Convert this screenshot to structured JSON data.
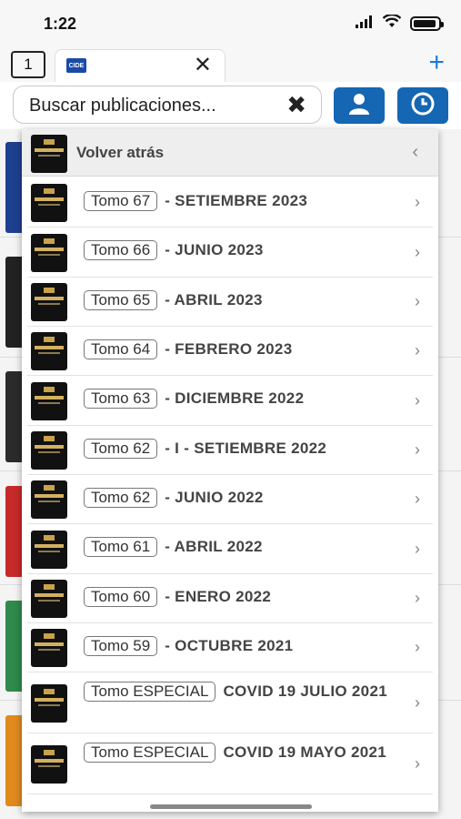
{
  "status_bar": {
    "time": "1:22"
  },
  "tabs": {
    "count": "1",
    "favicon_text": "CIDE"
  },
  "search": {
    "placeholder": "Buscar publicaciones..."
  },
  "menu": {
    "back_label": "Volver atrás",
    "items": [
      {
        "tomo": "Tomo 67",
        "title": "- SETIEMBRE 2023"
      },
      {
        "tomo": "Tomo 66",
        "title": "- JUNIO 2023"
      },
      {
        "tomo": "Tomo 65",
        "title": "- ABRIL 2023"
      },
      {
        "tomo": "Tomo 64",
        "title": "- FEBRERO 2023"
      },
      {
        "tomo": "Tomo 63",
        "title": "- DICIEMBRE 2022"
      },
      {
        "tomo": "Tomo 62",
        "title": "- I - SETIEMBRE 2022"
      },
      {
        "tomo": "Tomo 62",
        "title": "- JUNIO 2022"
      },
      {
        "tomo": "Tomo 61",
        "title": "- ABRIL 2022"
      },
      {
        "tomo": "Tomo 60",
        "title": "- ENERO 2022"
      },
      {
        "tomo": "Tomo 59",
        "title": "- OCTUBRE 2021"
      },
      {
        "tomo": "Tomo ESPECIAL",
        "title": "COVID 19 JULIO 2021"
      },
      {
        "tomo": "Tomo ESPECIAL",
        "title": "COVID 19 MAYO 2021"
      }
    ]
  },
  "colors": {
    "accent": "#1567b3",
    "new_tab": "#1a7ad6"
  },
  "icons": {
    "user": "user-icon",
    "history": "clock-icon",
    "clear": "close-icon",
    "chevron": "chevron-right-icon"
  }
}
